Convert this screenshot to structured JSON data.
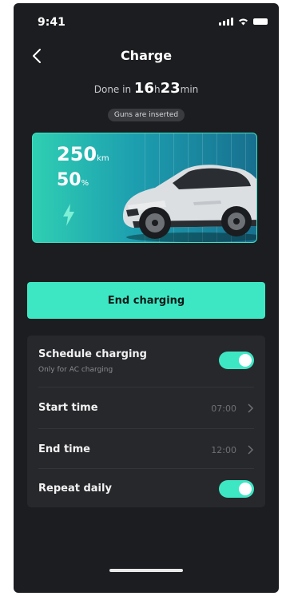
{
  "status_bar": {
    "time": "9:41"
  },
  "header": {
    "title": "Charge"
  },
  "charge_status": {
    "prefix": "Done in",
    "hours": "16",
    "hours_unit": "h",
    "minutes": "23",
    "minutes_unit": "min",
    "badge": "Guns are inserted"
  },
  "vehicle": {
    "range_value": "250",
    "range_unit": "km",
    "battery_value": "50",
    "battery_unit": "%"
  },
  "actions": {
    "end_charging": "End charging"
  },
  "settings": {
    "schedule_label": "Schedule charging",
    "schedule_sub": "Only for AC charging",
    "schedule_enabled": true,
    "start_label": "Start time",
    "start_value": "07:00",
    "end_label": "End time",
    "end_value": "12:00",
    "repeat_label": "Repeat daily",
    "repeat_enabled": true
  },
  "colors": {
    "accent": "#3ee7c4",
    "background": "#1c1d20",
    "card": "#27282c"
  }
}
